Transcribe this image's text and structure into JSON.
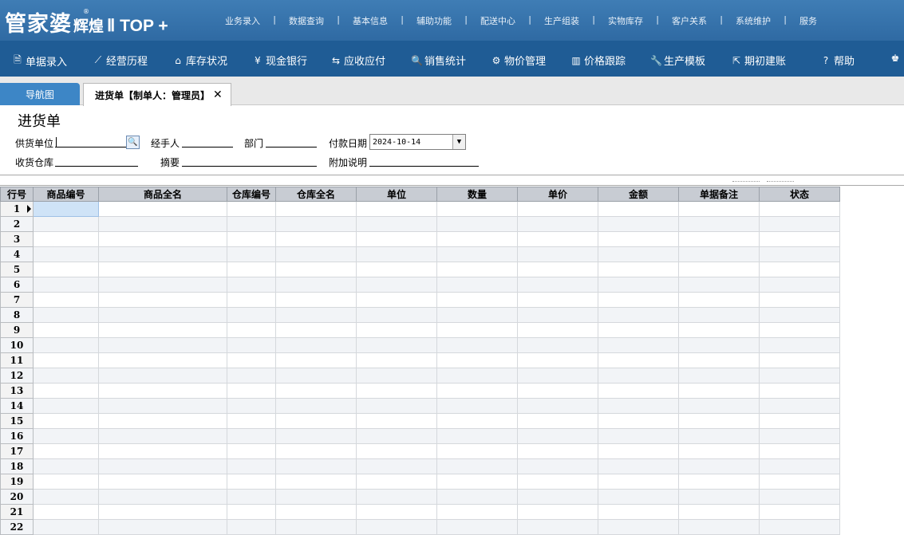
{
  "brand": {
    "name": "管家婆",
    "edition": "辉煌",
    "version": "Ⅱ TOP +",
    "reg": "®"
  },
  "top_menu": [
    "业务录入",
    "数据查询",
    "基本信息",
    "辅助功能",
    "配送中心",
    "生产组装",
    "实物库存",
    "客户关系",
    "系统维护",
    "服务"
  ],
  "toolbar": [
    {
      "label": "单据录入",
      "icon": "document-icon",
      "glyph": "🗎"
    },
    {
      "label": "经营历程",
      "icon": "chart-line-icon",
      "glyph": "⟋"
    },
    {
      "label": "库存状况",
      "icon": "home-icon",
      "glyph": "⌂"
    },
    {
      "label": "现金银行",
      "icon": "yen-icon",
      "glyph": "¥"
    },
    {
      "label": "应收应付",
      "icon": "transfer-icon",
      "glyph": "⇆"
    },
    {
      "label": "销售统计",
      "icon": "search-icon",
      "glyph": "🔍"
    },
    {
      "label": "物价管理",
      "icon": "gear-icon",
      "glyph": "⚙"
    },
    {
      "label": "价格跟踪",
      "icon": "bar-chart-icon",
      "glyph": "▥"
    },
    {
      "label": "生产模板",
      "icon": "wrench-icon",
      "glyph": "🔧"
    },
    {
      "label": "期初建账",
      "icon": "export-icon",
      "glyph": "⇱"
    },
    {
      "label": "帮助",
      "icon": "help-icon",
      "glyph": "?"
    },
    {
      "label": "",
      "icon": "money-bag-icon",
      "glyph": "♚"
    }
  ],
  "tabs": {
    "nav": "导航图",
    "active": "进货单【制单人：管理员】",
    "close": "✕"
  },
  "form": {
    "title": "进货单",
    "supplier_label": "供货单位",
    "handler_label": "经手人",
    "dept_label": "部门",
    "pay_date_label": "付款日期",
    "pay_date_value": "2024-10-14",
    "warehouse_label": "收货仓库",
    "summary_label": "摘要",
    "note_label": "附加说明"
  },
  "grid": {
    "columns": [
      "行号",
      "商品编号",
      "商品全名",
      "仓库编号",
      "仓库全名",
      "单位",
      "数量",
      "单价",
      "金额",
      "单据备注",
      "状态"
    ],
    "rows": [
      "1",
      "2",
      "3",
      "4",
      "5",
      "6",
      "7",
      "8",
      "9",
      "10",
      "11",
      "12",
      "13",
      "14",
      "15",
      "16",
      "17",
      "18",
      "19",
      "20",
      "21",
      "22"
    ]
  }
}
